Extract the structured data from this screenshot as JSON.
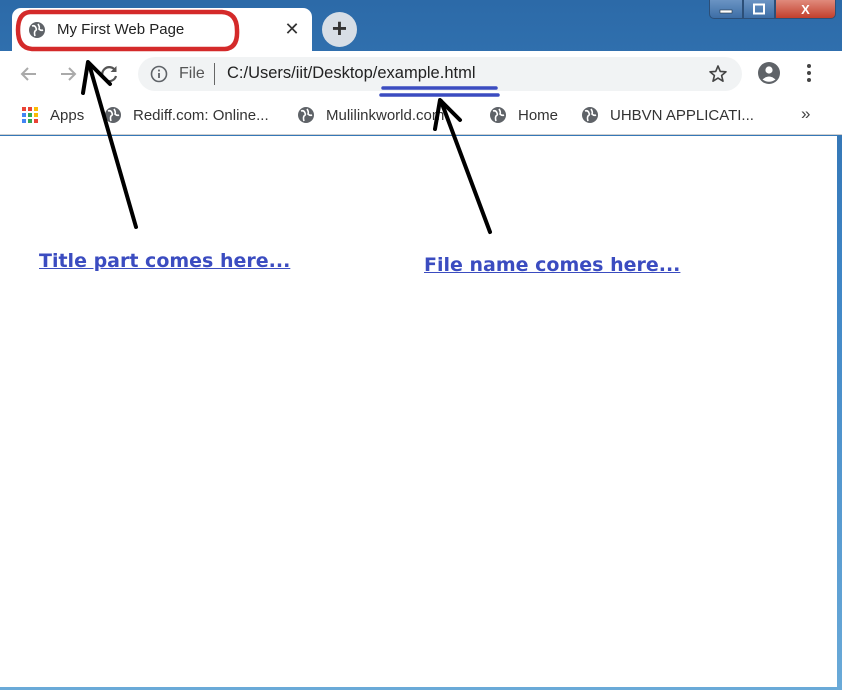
{
  "window": {
    "controls": {
      "minimize": "—",
      "maximize": "▢",
      "close": "X"
    }
  },
  "tab": {
    "title": "My First Web Page",
    "close_glyph": "✕",
    "new_tab_glyph": "+",
    "icon": "globe-icon"
  },
  "toolbar": {
    "back_icon": "back-arrow-icon",
    "forward_icon": "forward-arrow-icon",
    "reload_icon": "reload-icon",
    "profile_icon": "account-circle-icon",
    "menu_icon": "three-dots-menu-icon"
  },
  "omnibox": {
    "scheme": "File",
    "url": "C:/Users/iit/Desktop/example.html",
    "info_icon": "info-icon",
    "bookmark_icon": "star-icon"
  },
  "bookmarks": {
    "items": [
      {
        "label": "Apps",
        "icon": "apps-grid-icon"
      },
      {
        "label": "Rediff.com: Online...",
        "icon": "globe-icon"
      },
      {
        "label": "Mulilinkworld.com",
        "icon": "globe-icon"
      },
      {
        "label": "Home",
        "icon": "globe-icon"
      },
      {
        "label": "UHBVN APPLICATI...",
        "icon": "globe-icon"
      }
    ],
    "overflow": "»"
  },
  "annotations": {
    "title_note": "Title part comes here...",
    "file_note": "File name comes here..."
  },
  "colors": {
    "annotation_text": "#3b4cc0",
    "tab_highlight": "#d42a2a",
    "url_underline": "#3b4cc0",
    "arrow": "#000000",
    "apps_grid": [
      "#ea4335",
      "#fbbc05",
      "#34a853",
      "#4285f4"
    ]
  }
}
